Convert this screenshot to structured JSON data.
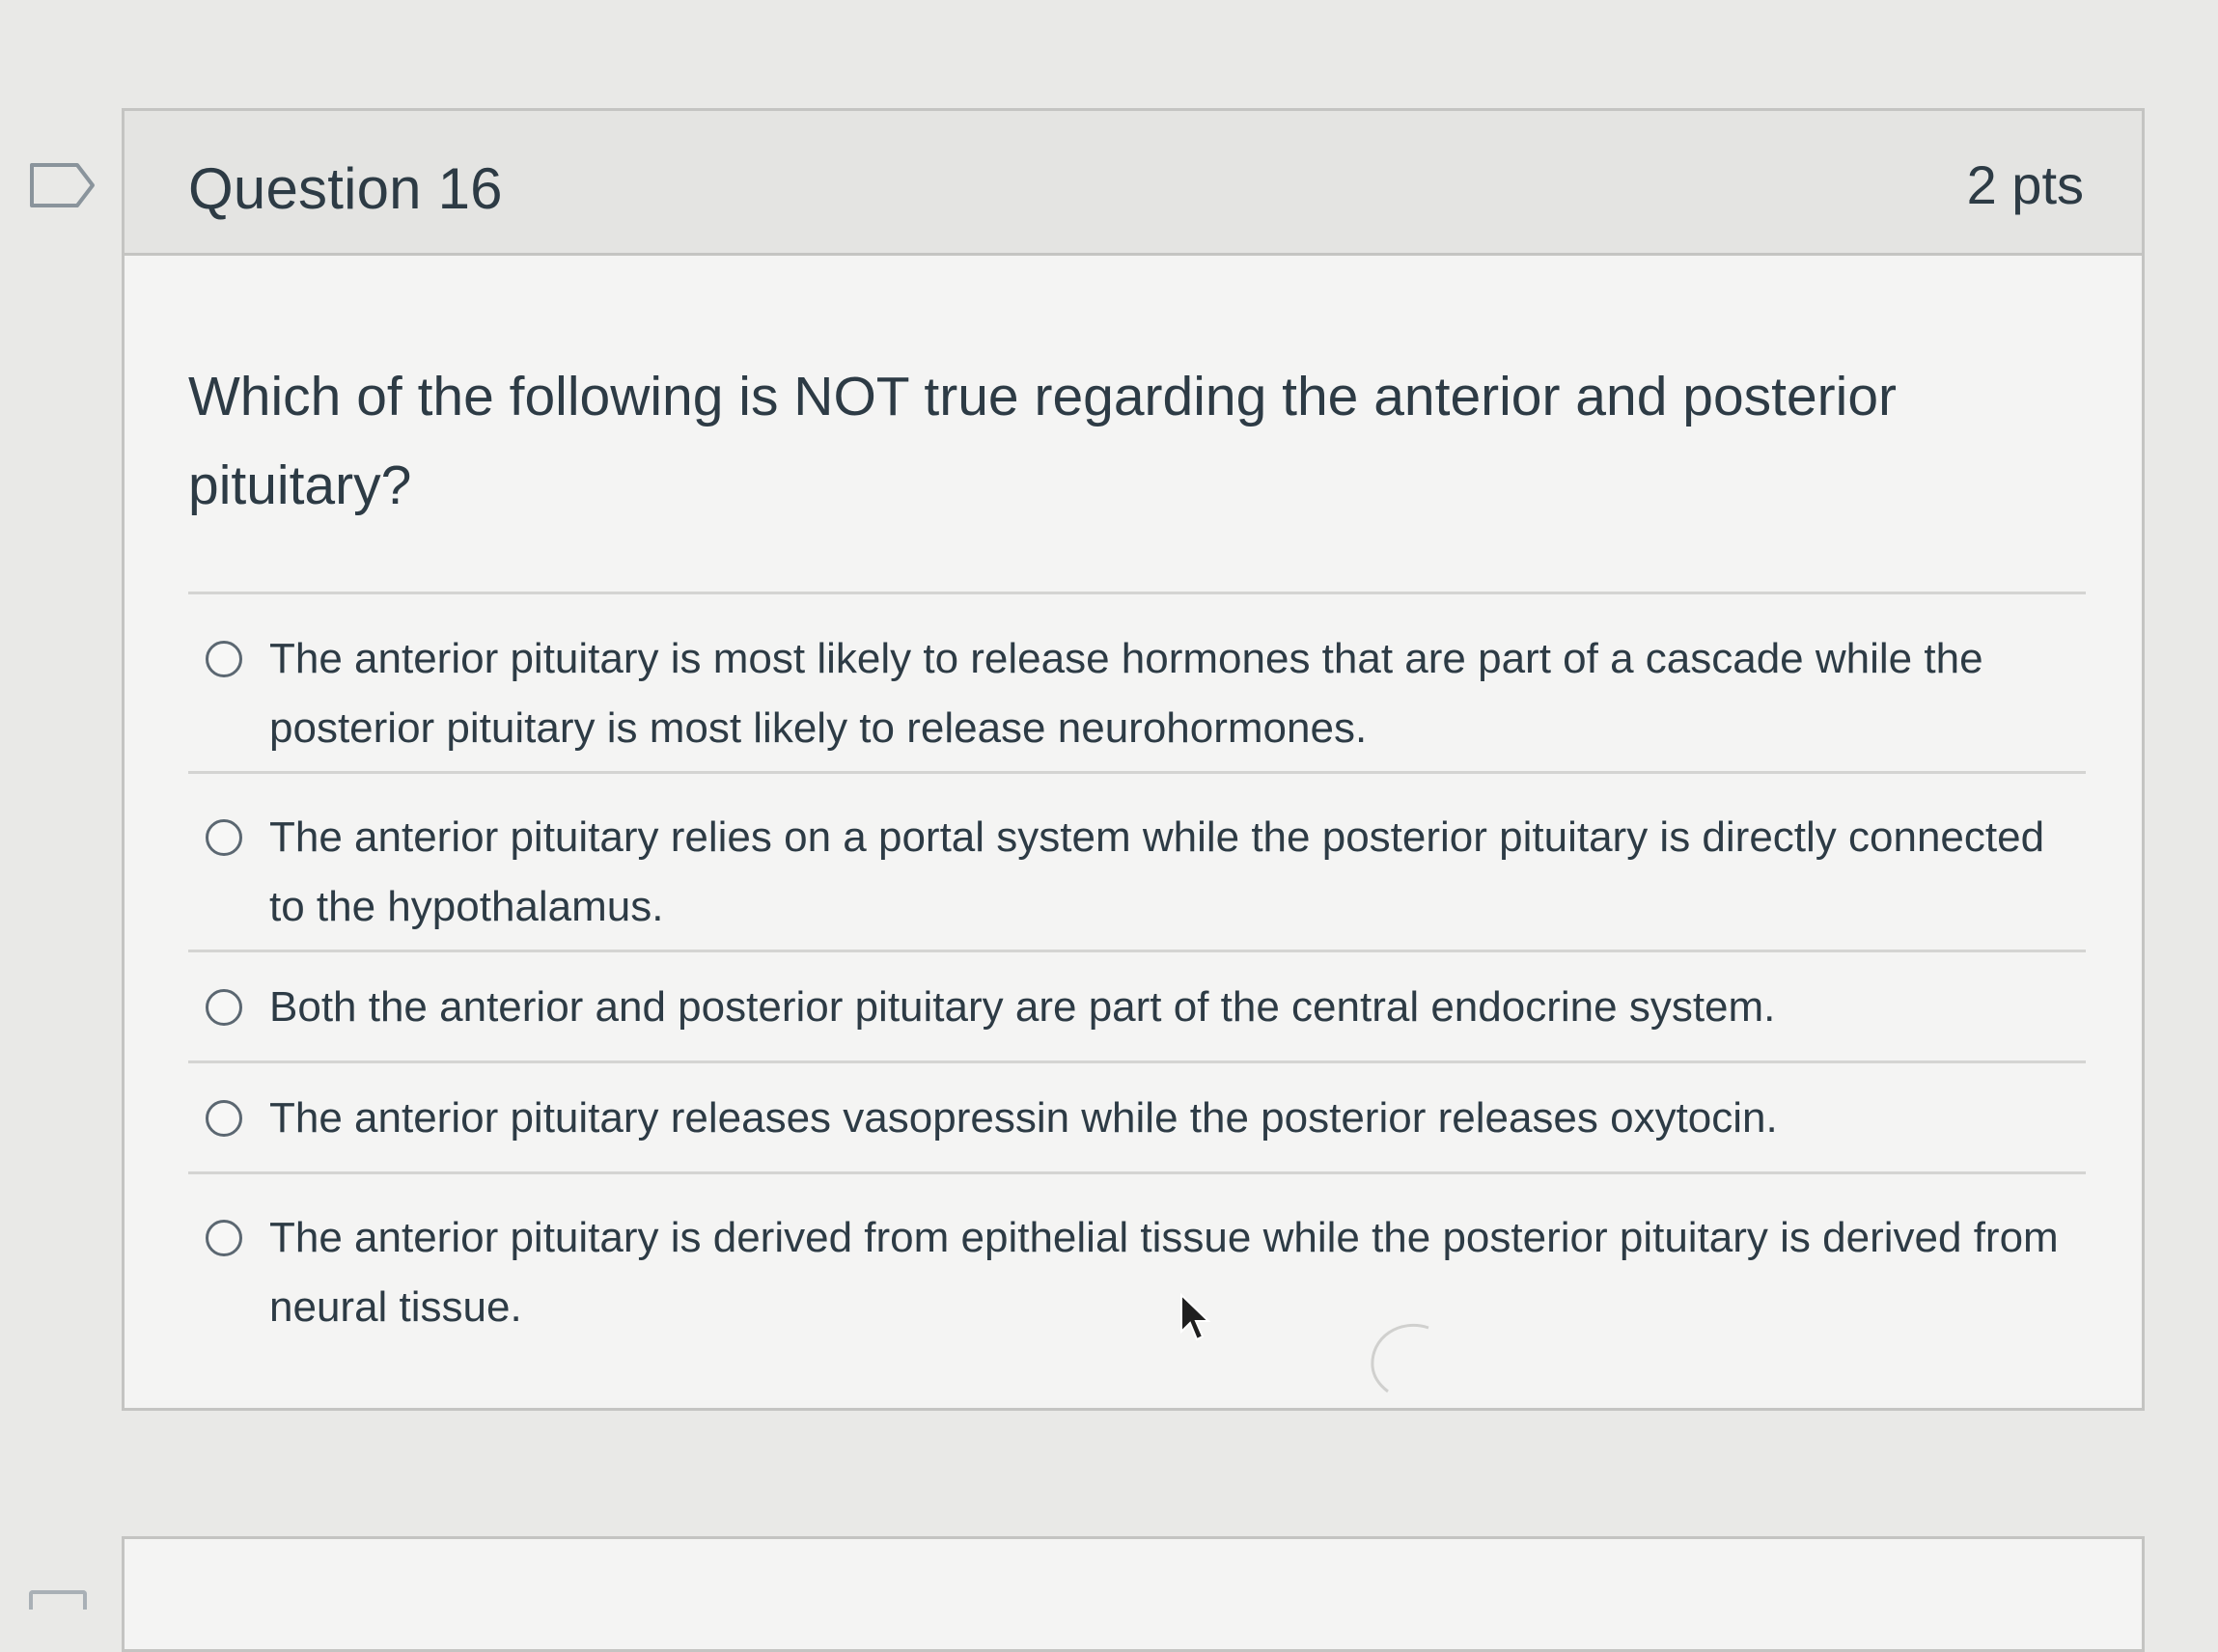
{
  "question": {
    "title": "Question 16",
    "points": "2 pts",
    "text": "Which of the following is NOT true regarding the anterior and posterior pituitary?",
    "flag_icon": "bookmark-flag-icon"
  },
  "answers": [
    {
      "label": "The anterior pituitary is most likely to release hormones that are part of a cascade while the posterior pituitary is most likely to release neurohormones.",
      "selected": false
    },
    {
      "label": "The anterior pituitary relies on a portal system while the posterior pituitary is directly connected to the hypothalamus.",
      "selected": false
    },
    {
      "label": "Both the anterior and posterior pituitary are part of the central endocrine system.",
      "selected": false
    },
    {
      "label": "The anterior pituitary releases vasopressin while the posterior releases oxytocin.",
      "selected": false
    },
    {
      "label": "The anterior pituitary is derived from epithelial tissue while the posterior pituitary is derived from neural tissue.",
      "selected": false
    }
  ],
  "colors": {
    "text": "#2d3b45",
    "header_bg": "#e4e4e2",
    "card_bg": "#f4f4f3",
    "border": "#c4c4c2",
    "page_bg": "#e9e9e7"
  }
}
